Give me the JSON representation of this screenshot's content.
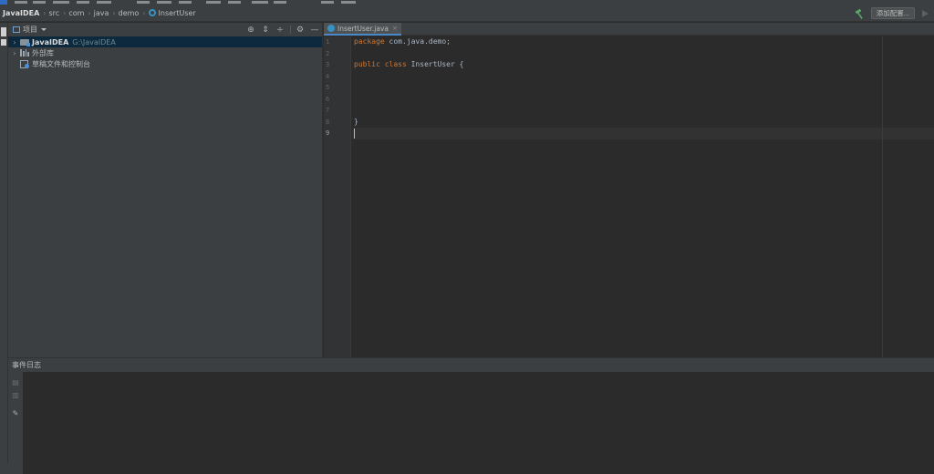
{
  "navbar": {
    "breadcrumbs": [
      "JavaIDEA",
      "src",
      "com",
      "java",
      "demo",
      "InsertUser"
    ],
    "add_config_label": "添加配置..."
  },
  "project_panel": {
    "title": "项目",
    "tree": [
      {
        "label": "JavaIDEA",
        "path": "G:\\JavaIDEA",
        "selected": true
      },
      {
        "label": "外部库"
      },
      {
        "label": "草稿文件和控制台"
      }
    ]
  },
  "editor": {
    "tab_label": "InsertUser.java",
    "line_numbers": [
      "1",
      "2",
      "3",
      "4",
      "5",
      "6",
      "7",
      "8",
      "9"
    ],
    "current_line": 9,
    "code": {
      "line1_kw": "package",
      "line1_rest": " com.java.demo;",
      "line3_kw": "public class",
      "line3_rest": " InsertUser {",
      "line8": "}"
    }
  },
  "bottom_panel": {
    "title": "事件日志"
  },
  "colors": {
    "keyword": "#cc7832",
    "text": "#a9b7c6",
    "selection": "#0d293e",
    "accent": "#4a88c7"
  }
}
